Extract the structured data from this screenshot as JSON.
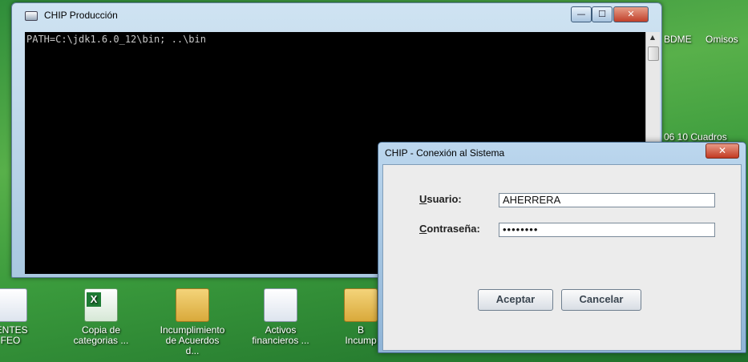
{
  "desktop": {
    "icons": [
      {
        "label_line1": "IENTES",
        "label_line2": "FEO",
        "type": "doc-icon"
      },
      {
        "label_line1": "Copia de",
        "label_line2": "categorias ...",
        "type": "excel-icon"
      },
      {
        "label_line1": "Incumplimiento",
        "label_line2": "de Acuerdos d...",
        "type": "folder-icon"
      },
      {
        "label_line1": "Activos",
        "label_line2": "financieros ...",
        "type": "doc-icon"
      },
      {
        "label_line1": "B",
        "label_line2": "Incump",
        "type": "folder-icon"
      }
    ],
    "right_labels": {
      "bdme": "BDME",
      "omisos": "Omisos",
      "partial": "06 10  Cuadros"
    }
  },
  "console_window": {
    "title": "CHIP Producción",
    "output": "PATH=C:\\jdk1.6.0_12\\bin; ..\\bin",
    "buttons": {
      "minimize": "—",
      "maximize": "☐",
      "close": "✕"
    }
  },
  "login_dialog": {
    "title": "CHIP - Conexión al Sistema",
    "close_label": "✕",
    "usuario_mnemonic": "U",
    "usuario_rest": "suario:",
    "usuario_value": "AHERRERA",
    "password_mnemonic": "C",
    "password_rest": "ontraseña:",
    "password_value": "••••••••",
    "accept_label": "Aceptar",
    "cancel_label": "Cancelar"
  }
}
